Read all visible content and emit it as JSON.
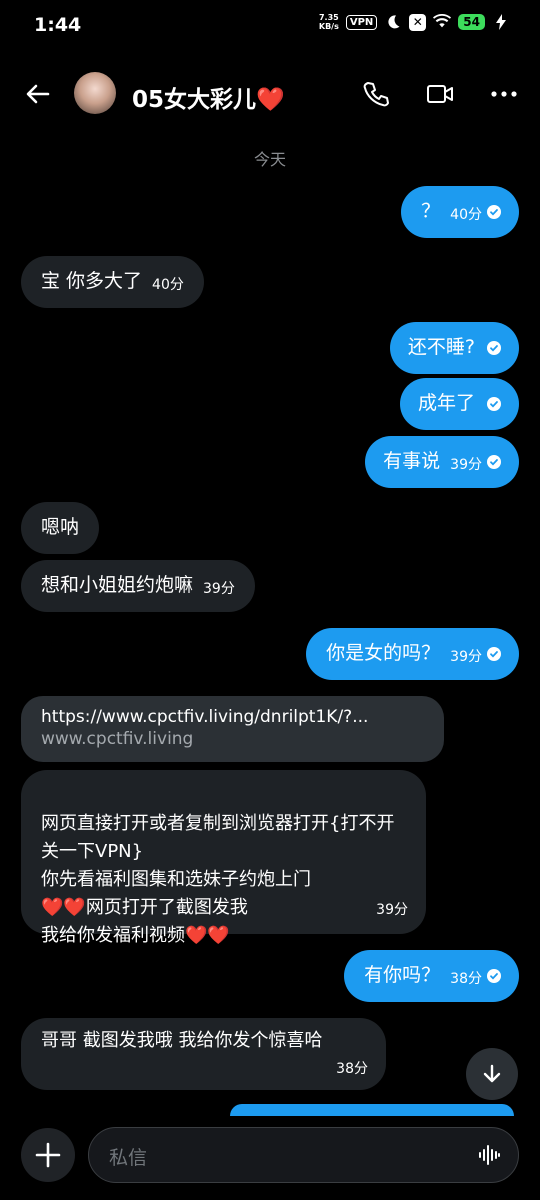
{
  "status": {
    "time": "1:44",
    "speed_value": "7.35",
    "speed_unit": "KB/s",
    "vpn": "VPN",
    "battery": "54"
  },
  "header": {
    "contact_name": "05女大彩儿❤️"
  },
  "chat": {
    "day_label": "今天",
    "messages": [
      {
        "dir": "out",
        "text": "？",
        "time": "40分"
      },
      {
        "dir": "in",
        "text": "宝 你多大了",
        "time": "40分"
      },
      {
        "dir": "out",
        "text": "还不睡?",
        "time": ""
      },
      {
        "dir": "out",
        "text": "成年了",
        "time": ""
      },
      {
        "dir": "out",
        "text": "有事说",
        "time": "39分"
      },
      {
        "dir": "in",
        "text": "嗯呐",
        "time": ""
      },
      {
        "dir": "in",
        "text": "想和小姐姐约炮嘛",
        "time": "39分"
      },
      {
        "dir": "out",
        "text": "你是女的吗？",
        "time": "39分"
      },
      {
        "dir": "in",
        "text": "网页直接打开或者复制到浏览器打开{打不开关一下VPN}\n你先看福利图集和选妹子约炮上门\n❤️❤️网页打开了截图发我\n 我给你发福利视频❤️❤️",
        "time": "39分"
      },
      {
        "dir": "out",
        "text": "有你吗？",
        "time": "38分"
      },
      {
        "dir": "in",
        "text": "哥哥 截图发我哦  我给你发个惊喜哈",
        "time": "38分"
      }
    ],
    "link_card": {
      "url": "https://www.cpctfiv.living/dnrilpt1K/?...",
      "domain": "www.cpctfiv.living"
    }
  },
  "composer": {
    "placeholder": "私信"
  },
  "colors": {
    "outgoing": "#1d9bf0",
    "incoming": "#1e2226",
    "background": "#000000"
  },
  "icons": [
    "back-arrow-icon",
    "phone-icon",
    "video-icon",
    "more-icon",
    "check-icon",
    "scroll-down-icon",
    "plus-icon",
    "voice-icon"
  ]
}
